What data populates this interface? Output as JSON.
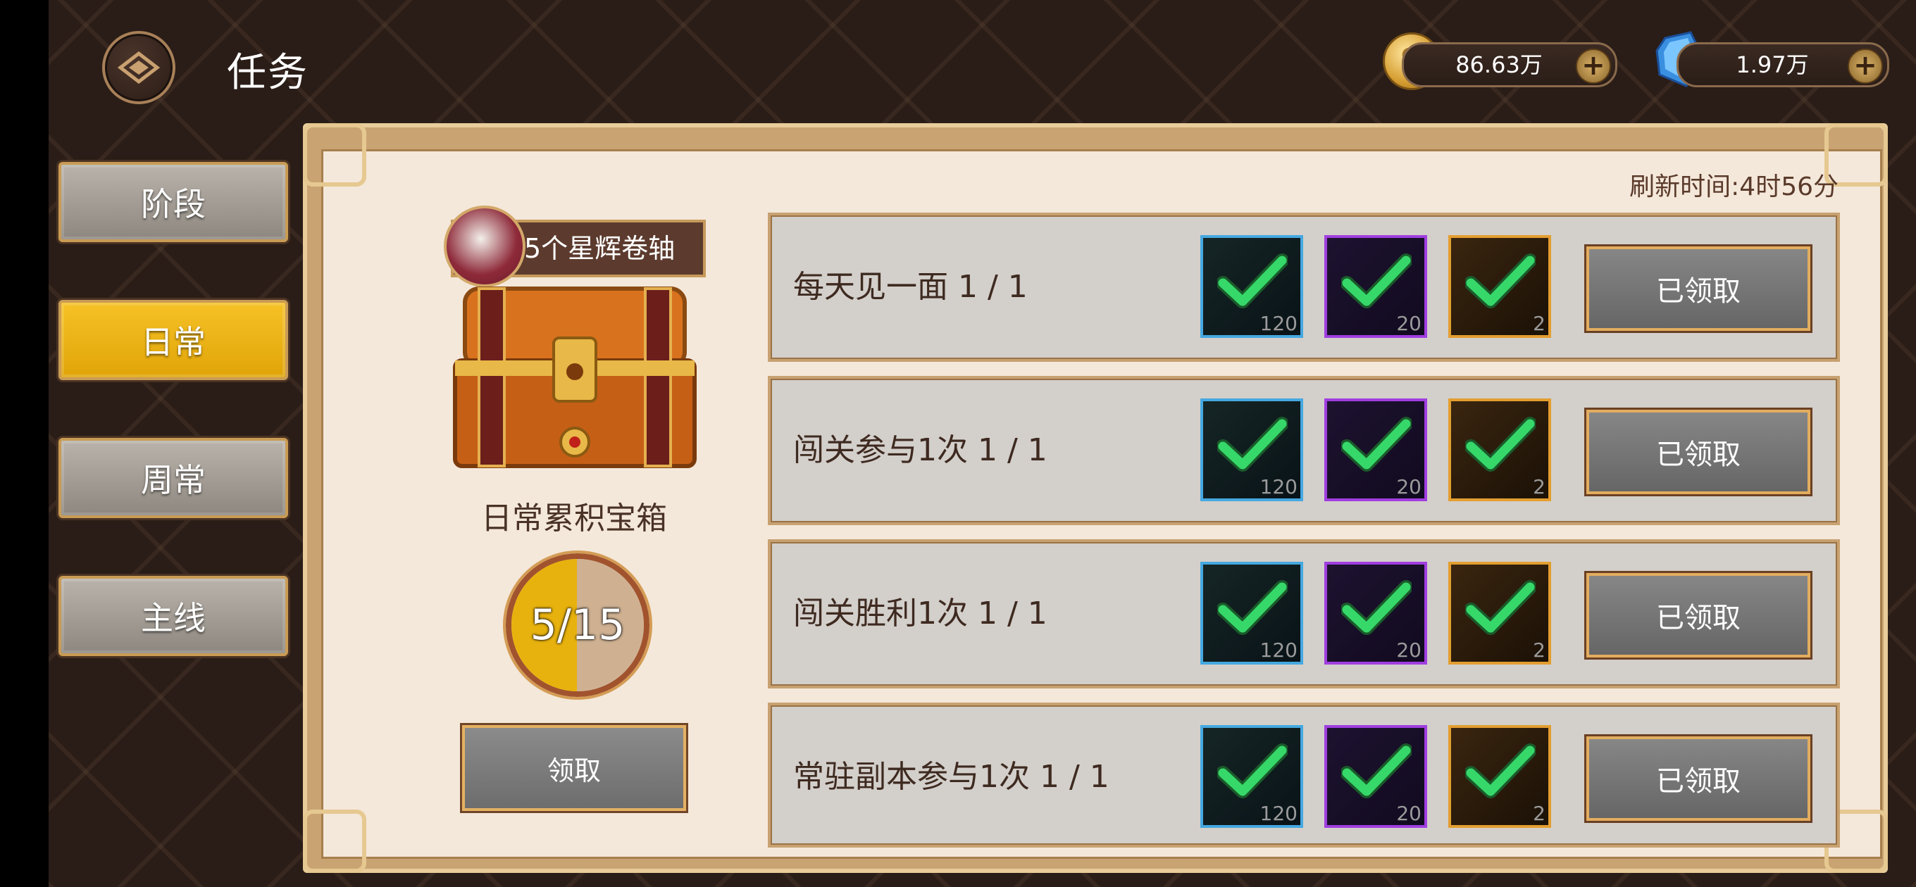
{
  "header": {
    "title": "任务",
    "gold": "86.63万",
    "gems": "1.97万"
  },
  "tabs": [
    {
      "label": "阶段",
      "active": false
    },
    {
      "label": "日常",
      "active": true
    },
    {
      "label": "周常",
      "active": false
    },
    {
      "label": "主线",
      "active": false
    }
  ],
  "panel": {
    "refresh": "刷新时间:4时56分",
    "reward_tag": "5个星辉卷轴",
    "chest_title": "日常累积宝箱",
    "progress_text": "5/15",
    "progress_value": 0.33,
    "claim_label": "领取"
  },
  "quests": [
    {
      "name": "每天见一面 1 / 1",
      "rewards": [
        {
          "qty": "120"
        },
        {
          "qty": "20"
        },
        {
          "qty": "2"
        }
      ],
      "button": "已领取"
    },
    {
      "name": "闯关参与1次 1 / 1",
      "rewards": [
        {
          "qty": "120"
        },
        {
          "qty": "20"
        },
        {
          "qty": "2"
        }
      ],
      "button": "已领取"
    },
    {
      "name": "闯关胜利1次 1 / 1",
      "rewards": [
        {
          "qty": "120"
        },
        {
          "qty": "20"
        },
        {
          "qty": "2"
        }
      ],
      "button": "已领取"
    },
    {
      "name": "常驻副本参与1次 1 / 1",
      "rewards": [
        {
          "qty": "120"
        },
        {
          "qty": "20"
        },
        {
          "qty": "2"
        }
      ],
      "button": "已领取"
    }
  ]
}
